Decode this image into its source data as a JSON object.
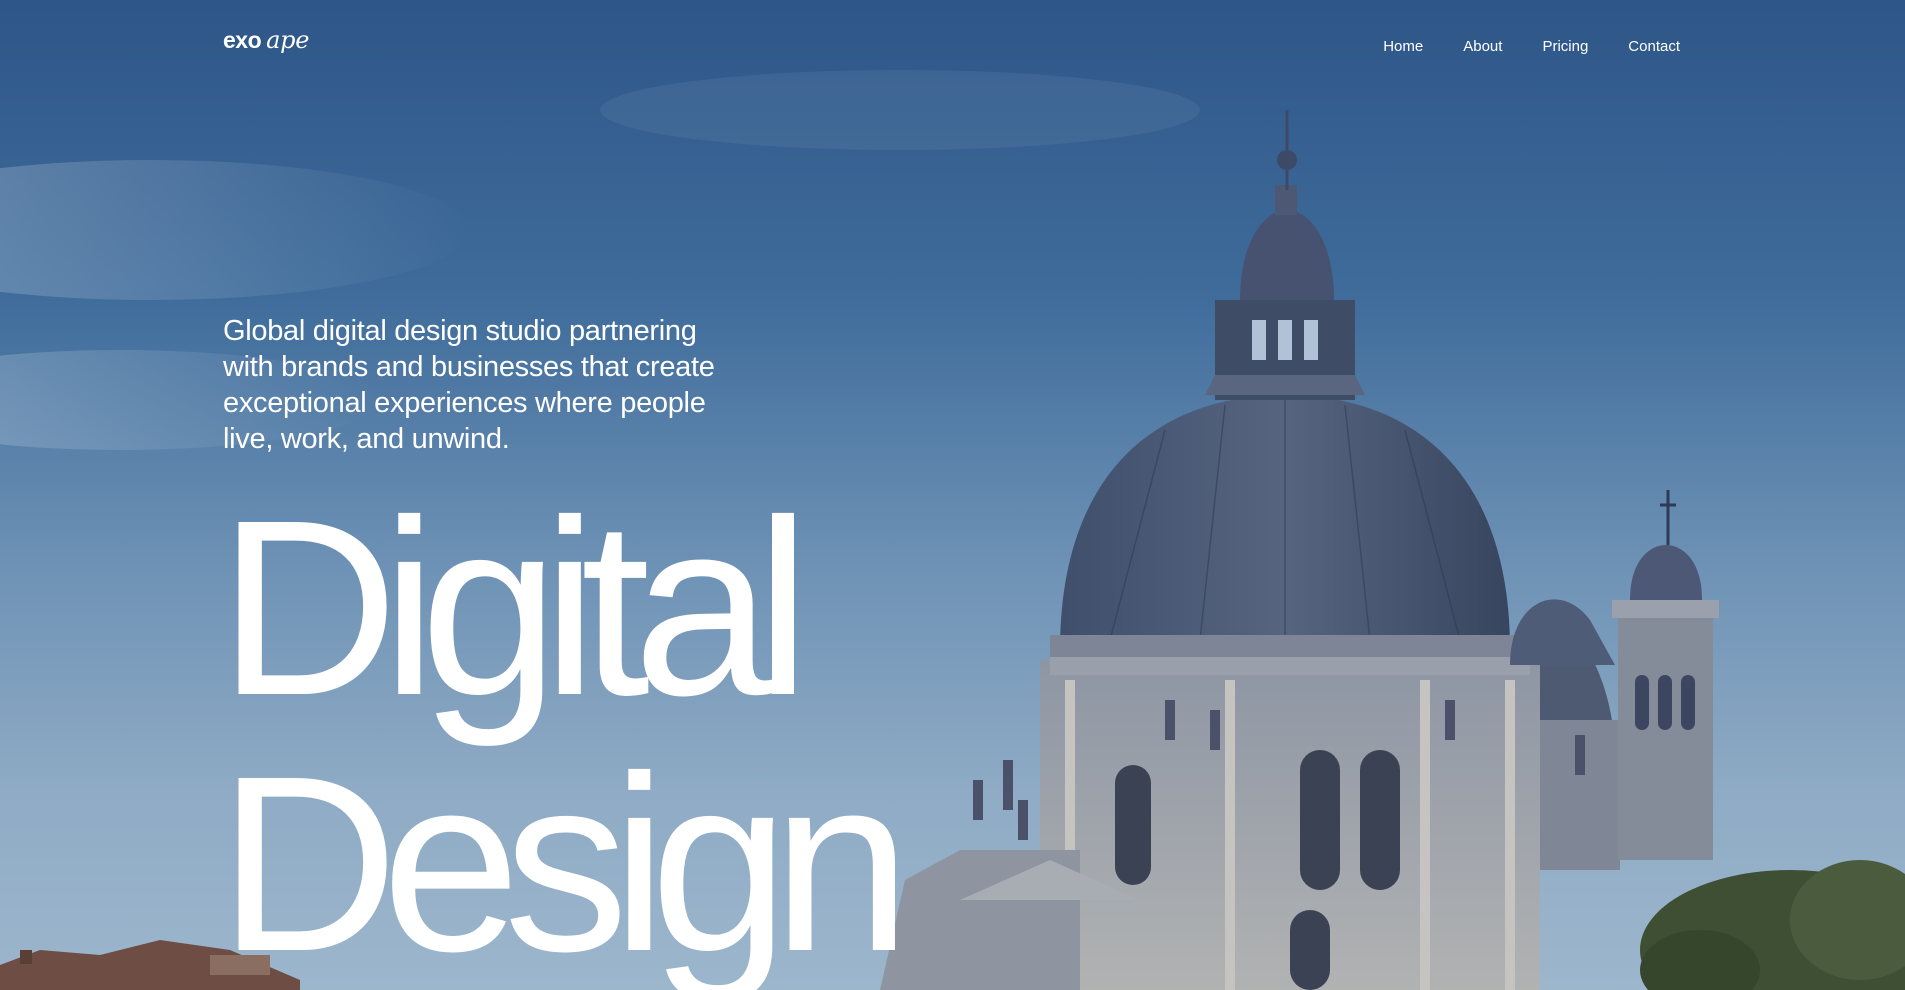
{
  "logo": {
    "primary": "exo",
    "secondary": "ape"
  },
  "nav": {
    "items": [
      {
        "label": "Home"
      },
      {
        "label": "About"
      },
      {
        "label": "Pricing"
      },
      {
        "label": "Contact"
      }
    ]
  },
  "hero": {
    "tagline": "Global digital design studio partnering with brands and businesses that create exceptional experiences where people live, work, and unwind.",
    "headline_line1": "Digital",
    "headline_line2": "Design",
    "background": "Photograph of a domed baroque basilica against a blue evening sky"
  },
  "colors": {
    "sky_top": "#2e5688",
    "sky_bottom": "#9cb6cc",
    "text": "#ffffff"
  }
}
